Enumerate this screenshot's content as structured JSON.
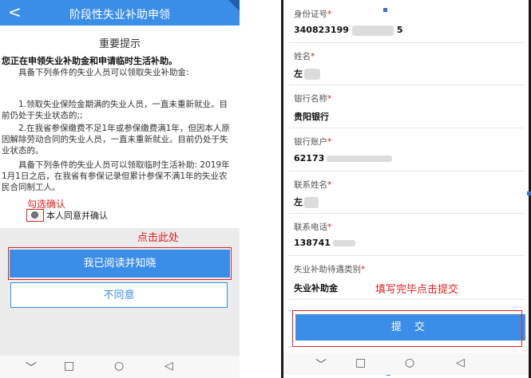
{
  "left": {
    "header": {
      "back": "<",
      "title": "阶段性失业补助申领"
    },
    "notice_title": "重要提示",
    "bold_line": "您正在申领失业补助金和申请临时生活补助。",
    "text1": "具备下列条件的失业人员可以领取失业补助金:",
    "text2": "1.领取失业保险金期满的失业人员，一直未重新就业。目前仍处于失业状态的;;",
    "text3": "2.在我省参保缴费不足1年或参保缴费满1年，但因本人原因解除劳动合同的失业人员，一直未重新就业。目前仍处于失业状态的。",
    "text4": "具备下列条件的失业人员可以领取临时生活补助: 2019年1月1日之后，在我省有参保记录但累计参保不满1年的失业农民合同制工人。",
    "check_hint": "勾选确认",
    "check_label": "本人同意并确认",
    "click_hint": "点击此处",
    "read_button": "我已阅读并知晓",
    "disagree_button": "不同意"
  },
  "right": {
    "fields": [
      {
        "label": "身份证号",
        "value": "340823199",
        "suffix": "5"
      },
      {
        "label": "姓名",
        "value": "左"
      },
      {
        "label": "银行名称",
        "value": "贵阳银行"
      },
      {
        "label": "银行账户",
        "value": "62173"
      },
      {
        "label": "联系姓名",
        "value": "左"
      },
      {
        "label": "联系电话",
        "value": "138741"
      },
      {
        "label": "失业补助待遇类别",
        "value": "失业补助金"
      }
    ],
    "required_mark": "*",
    "fill_hint": "填写完毕点击提交",
    "submit_button": "提 交"
  },
  "nav": {
    "back": "﹀",
    "home": "□",
    "recent": "○",
    "triangle": "◁"
  },
  "colors": {
    "primary": "#3b8ee8",
    "annotation": "#e02020"
  }
}
